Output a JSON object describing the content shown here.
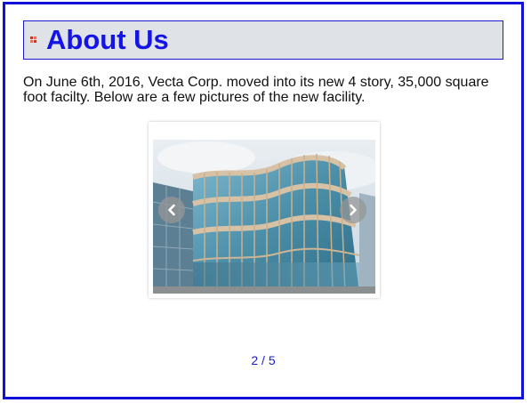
{
  "page": {
    "title": "About Us",
    "intro": "On June 6th, 2016, Vecta Corp. moved into its new 4 story, 35,000 square foot facilty. Below are a few pictures of the new facility."
  },
  "slideshow": {
    "counter": "2 / 5",
    "current": 2,
    "total": 5,
    "prev_icon": "chevron-left-icon",
    "next_icon": "chevron-right-icon"
  },
  "colors": {
    "frame_border": "#1010d8",
    "title_bg": "#dfe2e6",
    "title_text": "#1414e6",
    "counter_text": "#1a1acc"
  }
}
